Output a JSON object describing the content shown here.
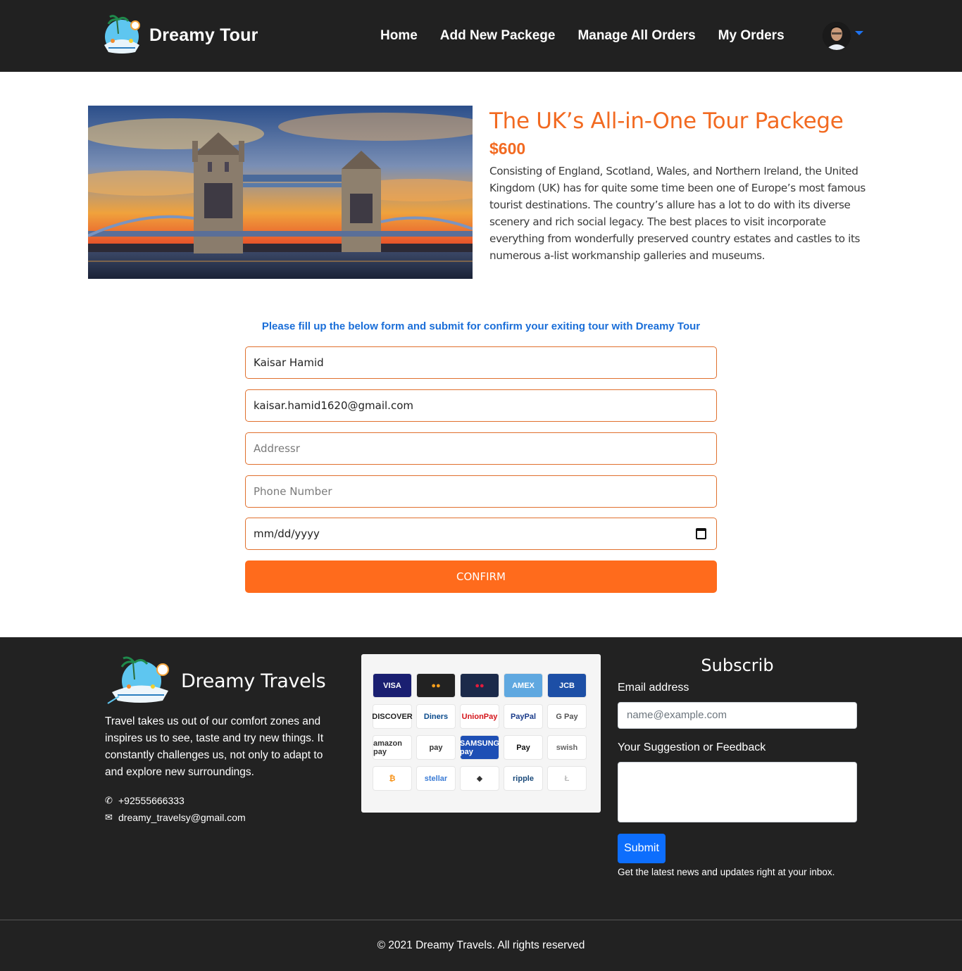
{
  "navbar": {
    "brand": "Dreamy Tour",
    "links": [
      "Home",
      "Add New Packege",
      "Manage All Orders",
      "My Orders"
    ],
    "avatar_icon": "user-avatar"
  },
  "product": {
    "title": "The UK’s All-in-One Tour Packege",
    "price": "$600",
    "description": "Consisting of England, Scotland, Wales, and Northern Ireland, the United Kingdom (UK) has for quite some time been one of Europe’s most famous tourist destinations. The country’s allure has a lot to do with its diverse scenery and rich social legacy. The best places to visit incorporate everything from wonderfully preserved country estates and castles to its numerous a-list workmanship galleries and museums."
  },
  "form": {
    "heading": "Please fill up the below form and submit for confirm your exiting tour with Dreamy Tour",
    "name_value": "Kaisar Hamid",
    "email_value": "kaisar.hamid1620@gmail.com",
    "address_placeholder": "Addressr",
    "phone_placeholder": "Phone Number",
    "date_placeholder": "mm/dd/yyyy",
    "confirm_label": "CONFIRM"
  },
  "footer": {
    "brand": "Dreamy Travels",
    "about": "Travel takes us out of our comfort zones and inspires us to see, taste and try new things. It constantly challenges us, not only to adapt to and explore new surroundings.",
    "phone": "+92555666333",
    "email": "dreamy_travelsy@gmail.com",
    "payments": [
      {
        "label": "VISA",
        "bg": "#1a1f71",
        "fg": "#ffffff"
      },
      {
        "label": "●●",
        "bg": "#222222",
        "fg": "#f79e1b"
      },
      {
        "label": "●●",
        "bg": "#1b2a4a",
        "fg": "#e21b3c"
      },
      {
        "label": "AMEX",
        "bg": "#5fa8e0",
        "fg": "#ffffff"
      },
      {
        "label": "JCB",
        "bg": "#1d4fa6",
        "fg": "#ffffff"
      },
      {
        "label": "DISCOVER",
        "bg": "#ffffff",
        "fg": "#222222"
      },
      {
        "label": "Diners",
        "bg": "#ffffff",
        "fg": "#0a4a8c"
      },
      {
        "label": "UnionPay",
        "bg": "#ffffff",
        "fg": "#d4141a"
      },
      {
        "label": "PayPal",
        "bg": "#ffffff",
        "fg": "#1a3b8a"
      },
      {
        "label": "G Pay",
        "bg": "#ffffff",
        "fg": "#555555"
      },
      {
        "label": "amazon pay",
        "bg": "#ffffff",
        "fg": "#333333"
      },
      {
        "label": "pay",
        "bg": "#ffffff",
        "fg": "#333333"
      },
      {
        "label": "SAMSUNG pay",
        "bg": "#1e4fb5",
        "fg": "#ffffff"
      },
      {
        "label": " Pay",
        "bg": "#ffffff",
        "fg": "#111111"
      },
      {
        "label": "swish",
        "bg": "#ffffff",
        "fg": "#666666"
      },
      {
        "label": "₿",
        "bg": "#ffffff",
        "fg": "#f7931a"
      },
      {
        "label": "stellar",
        "bg": "#ffffff",
        "fg": "#3a7bd5"
      },
      {
        "label": "◆",
        "bg": "#ffffff",
        "fg": "#333333"
      },
      {
        "label": "ripple",
        "bg": "#ffffff",
        "fg": "#1a4a7a"
      },
      {
        "label": "Ł",
        "bg": "#ffffff",
        "fg": "#bbbbbb"
      }
    ],
    "subscribe": {
      "title": "Subscrib",
      "email_label": "Email address",
      "email_placeholder": "name@example.com",
      "feedback_label": "Your Suggestion or Feedback",
      "submit_label": "Submit",
      "note": "Get the latest news and updates right at your inbox."
    },
    "copyright": "© 2021 Dreamy Travels. All rights reserved"
  }
}
